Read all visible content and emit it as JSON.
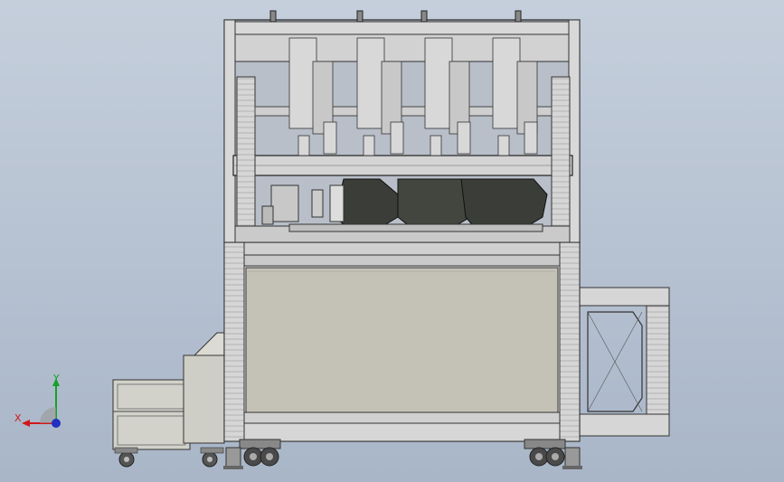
{
  "viewport": {
    "background_top": "#c5cfdc",
    "background_bottom": "#a9b6c8"
  },
  "model": {
    "icon": "machine-assembly-icon",
    "frame_color": "#d9d9d9",
    "panel_color": "#c4c2b6",
    "dark_parts_color": "#3a3d38"
  },
  "axes": {
    "x_label": "X",
    "y_label": "Y",
    "x_color": "#d01818",
    "y_color": "#18a028",
    "z_color": "#2030c0"
  }
}
